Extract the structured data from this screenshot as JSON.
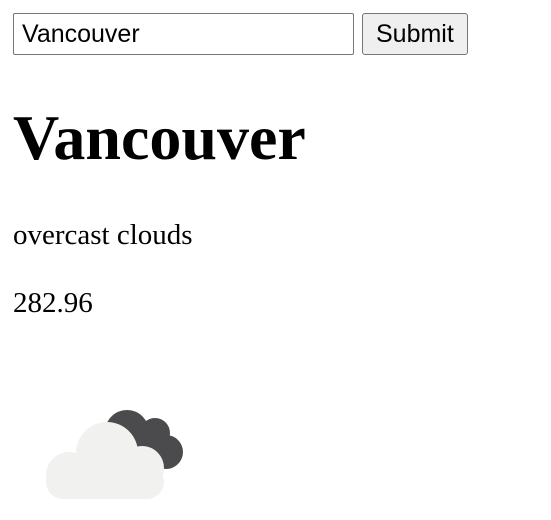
{
  "search": {
    "value": "Vancouver",
    "button_label": "Submit"
  },
  "weather": {
    "city": "Vancouver",
    "description": "overcast clouds",
    "temperature": "282.96",
    "icon": "overcast-clouds-icon"
  },
  "colors": {
    "cloud_front": "#f1f1f0",
    "cloud_back": "#4b4b4e"
  }
}
